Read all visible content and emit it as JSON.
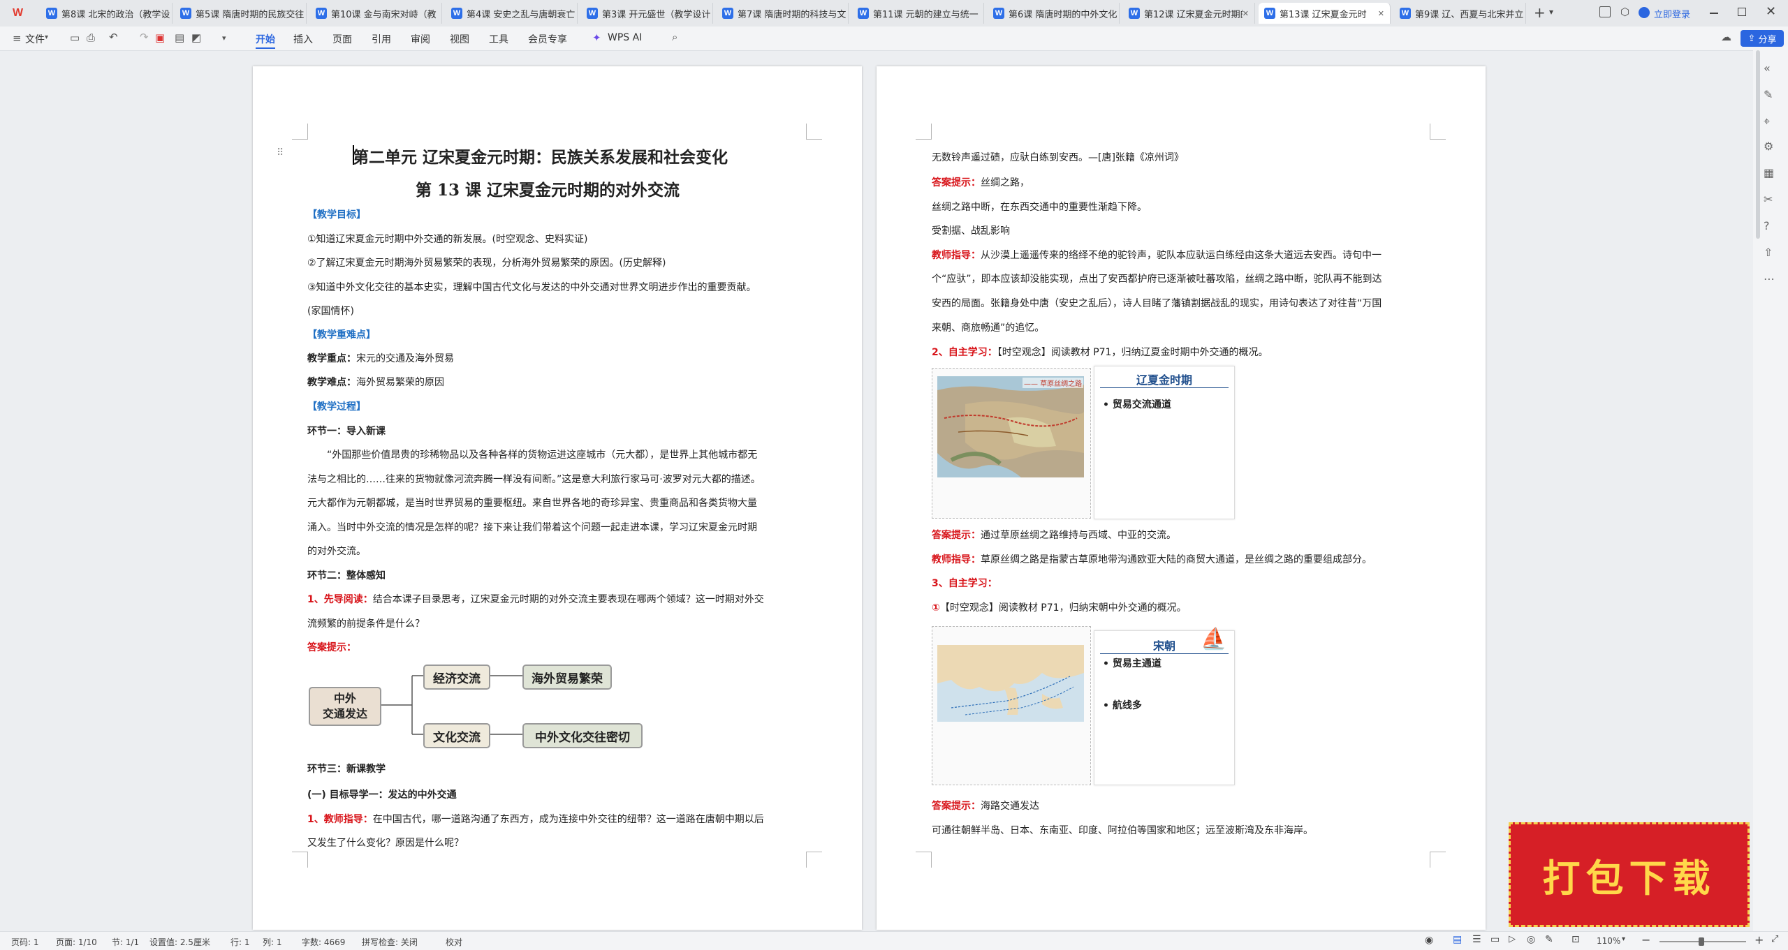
{
  "tabs": [
    {
      "label": "第8课 北宋的政治（教学设"
    },
    {
      "label": "第5课 隋唐时期的民族交往"
    },
    {
      "label": "第10课 金与南宋对峙（教"
    },
    {
      "label": "第4课 安史之乱与唐朝衰亡"
    },
    {
      "label": "第3课 开元盛世（教学设计"
    },
    {
      "label": "第7课 隋唐时期的科技与文"
    },
    {
      "label": "第11课 元朝的建立与统一"
    },
    {
      "label": "第6课 隋唐时期的中外文化"
    },
    {
      "label": "第12课 辽宋夏金元时期的"
    },
    {
      "label": "第13课 辽宋夏金元时"
    },
    {
      "label": "第9课 辽、西夏与北宋并立"
    }
  ],
  "titlebar": {
    "login": "立即登录",
    "add_tab": "+"
  },
  "toolbar": {
    "file": "文件",
    "menus": [
      "开始",
      "插入",
      "页面",
      "引用",
      "审阅",
      "视图",
      "工具",
      "会员专享"
    ],
    "wps_ai": "WPS AI",
    "share": "分享"
  },
  "left_page": {
    "unit_title": "第二单元  辽宋夏金元时期：民族关系发展和社会变化",
    "lesson_title": "第 13 课    辽宋夏金元时期的对外交流",
    "objectives_head": "【教学目标】",
    "obj1": "①知道辽宋夏金元时期中外交通的新发展。(时空观念、史料实证)",
    "obj2": "②了解辽宋夏金元时期海外贸易繁荣的表现，分析海外贸易繁荣的原因。(历史解释)",
    "obj3a": "③知道中外文化交往的基本史实，理解中国古代文化与发达的中外交通对世界文明进步作出的重要贡献。",
    "obj3b": "(家国情怀)",
    "keypoints_head": "【教学重难点】",
    "key_label": "教学重点：",
    "key_text": "宋元的交通及海外贸易",
    "diff_label": "教学难点：",
    "diff_text": "海外贸易繁荣的原因",
    "process_head": "【教学过程】",
    "step1": "环节一：导入新课",
    "intro1": "“外国那些价值昂贵的珍稀物品以及各种各样的货物运进这座城市（元大都），是世界上其他城市都无",
    "intro2": "法与之相比的……往来的货物就像河流奔腾一样没有间断。”这是意大利旅行家马可·波罗对元大都的描述。",
    "intro3": "元大都作为元朝都城，是当时世界贸易的重要枢纽。来自世界各地的奇珍异宝、贵重商品和各类货物大量",
    "intro4": "涌入。当时中外交流的情况是怎样的呢？接下来让我们带着这个问题一起走进本课，学习辽宋夏金元时期",
    "intro5": "的对外交流。",
    "step2": "环节二：整体感知",
    "read_label": "1、先导阅读：",
    "read_text1": "结合本课子目录思考，辽宋夏金元时期的对外交流主要表现在哪两个领域？这一时期对外交",
    "read_text2": "流频繁的前提条件是什么？",
    "answer_label": "答案提示：",
    "mindmap": {
      "root": [
        "中外",
        "交通发达"
      ],
      "branch1": "经济交流",
      "leaf1": "海外贸易繁荣",
      "branch2": "文化交流",
      "leaf2": "中外文化交往密切"
    },
    "step3": "环节三：新课教学",
    "sub1": "(一) 目标导学一：发达的中外交通",
    "teacher_label": "1、教师指导：",
    "teacher_text1": "在中国古代，哪一道路沟通了东西方，成为连接中外交往的纽带？这一道路在唐朝中期以后",
    "teacher_text2": "又发生了什么变化？原因是什么呢？"
  },
  "right_page": {
    "poem": "无数铃声遥过碛，应驮白练到安西。—[唐]张籍《凉州词》",
    "ans_label": "答案提示：",
    "ans1": "丝绸之路，",
    "ans2": "丝绸之路中断，在东西交通中的重要性渐趋下降。",
    "ans3": "受割据、战乱影响",
    "guide_label": "教师指导：",
    "guide1": "从沙漠上遥遥传来的络绎不绝的驼铃声，驼队本应驮运白练经由这条大道远去安西。诗句中一",
    "guide2": "个“应驮”，即本应该却没能实现，点出了安西都护府已逐渐被吐蕃攻陷，丝绸之路中断，驼队再不能到达",
    "guide3": "安西的局面。张籍身处中唐（安史之乱后），诗人目睹了藩镇割据战乱的现实，用诗句表达了对往昔“万国",
    "guide4": "来朝、商旅畅通”的追忆。",
    "self2_label": "2、自主学习：",
    "self2_text": "【时空观念】阅读教材 P71，归纳辽夏金时期中外交通的概况。",
    "card1_title": "辽夏金时期",
    "card1_bullet": "贸易交流通道",
    "map1_legend": "—— 草原丝绸之路",
    "ans4_label": "答案提示：",
    "ans4_text": "通过草原丝绸之路维持与西域、中亚的交流。",
    "guide5_label": "教师指导：",
    "guide5_text": "草原丝绸之路是指蒙古草原地带沟通欧亚大陆的商贸大通道，是丝绸之路的重要组成部分。",
    "self3_label": "3、自主学习：",
    "self3a_num": "①",
    "self3a_text": "【时空观念】阅读教材 P71，归纳宋朝中外交通的概况。",
    "card2_title": "宋朝",
    "card2_b1": "贸易主通道",
    "card2_b2": "航线多",
    "ans5_label": "答案提示：",
    "ans5_text": "海路交通发达",
    "ans6": "可通往朝鲜半岛、日本、东南亚、印度、阿拉伯等国家和地区；远至波斯湾及东非海岸。"
  },
  "status": {
    "page_label": "页码: 1",
    "pages": "页面: 1/10",
    "section": "节: 1/1",
    "setting": "设置值: 2.5厘米",
    "row": "行: 1",
    "col": "列: 1",
    "words": "字数: 4669",
    "spell": "拼写检查: 关闭",
    "proof": "校对",
    "zoom": "110%"
  },
  "promo": {
    "text": "打包下载"
  }
}
